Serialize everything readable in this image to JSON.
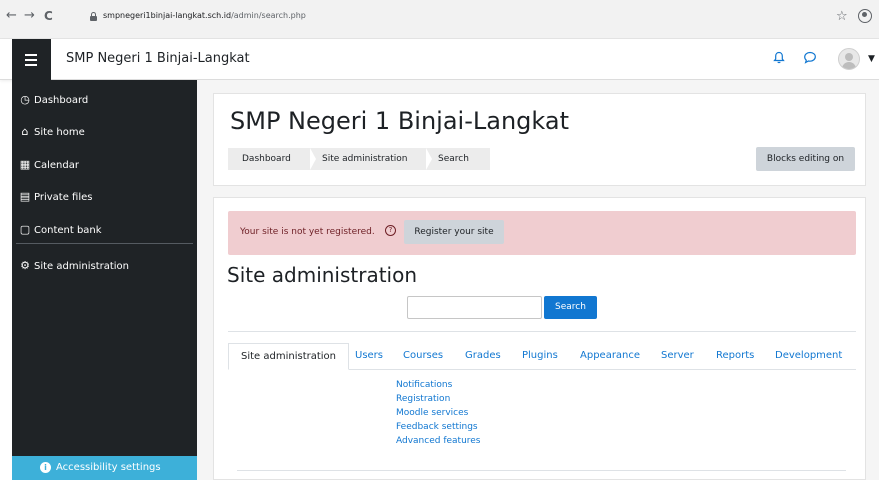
{
  "browser": {
    "back_glyph": "←",
    "forward_glyph": "→",
    "reload_glyph": "C",
    "url_host": "smpnegeri1binjai-langkat.sch.id",
    "url_path": "/admin/search.php",
    "star_glyph": "☆"
  },
  "navbar": {
    "site_name": "SMP Negeri 1 Binjai-Langkat",
    "bell_glyph": "♫",
    "chat_glyph": "◌",
    "caret_glyph": "▼"
  },
  "sidebar": {
    "items": [
      {
        "label": "Dashboard",
        "icon": "dashboard-icon",
        "glyph": "◷"
      },
      {
        "label": "Site home",
        "icon": "home-icon",
        "glyph": "⌂"
      },
      {
        "label": "Calendar",
        "icon": "calendar-icon",
        "glyph": "▦"
      },
      {
        "label": "Private files",
        "icon": "file-icon",
        "glyph": "▤"
      },
      {
        "label": "Content bank",
        "icon": "content-bank-icon",
        "glyph": "▢"
      },
      {
        "label": "Site administration",
        "icon": "gear-icon",
        "glyph": "⚙"
      }
    ],
    "accessibility_label": "Accessibility settings",
    "accessibility_glyph": "i"
  },
  "header": {
    "title": "SMP Negeri 1 Binjai-Langkat",
    "breadcrumb": [
      "Dashboard",
      "Site administration",
      "Search"
    ],
    "blocks_editing_label": "Blocks editing on"
  },
  "alert": {
    "text": "Your site is not yet registered.",
    "help_glyph": "?",
    "register_label": "Register your site"
  },
  "main": {
    "heading": "Site administration",
    "search_button": "Search",
    "search_value": "",
    "tabs": [
      "Site administration",
      "Users",
      "Courses",
      "Grades",
      "Plugins",
      "Appearance",
      "Server",
      "Reports",
      "Development"
    ],
    "active_tab": "Site administration",
    "links": [
      "Notifications",
      "Registration",
      "Moodle services",
      "Feedback settings",
      "Advanced features"
    ]
  },
  "colors": {
    "accent": "#1177d1",
    "sidebar_bg": "#1f2326",
    "alert_bg": "#f0cdd0",
    "accessibility_bg": "#3db0d9"
  }
}
